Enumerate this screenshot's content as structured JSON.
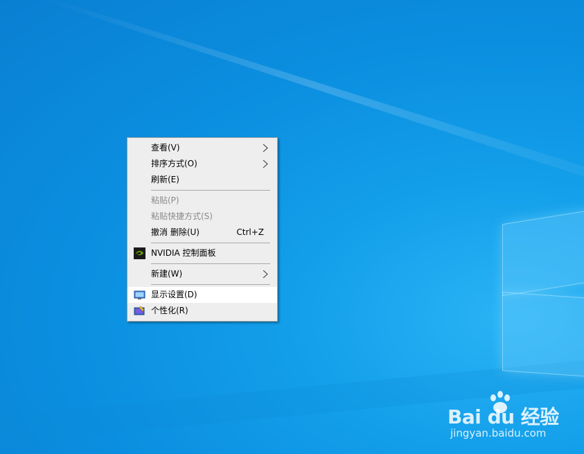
{
  "desktop": {
    "background_color": "#0b8fe0",
    "accent_color": "#2ab4f5"
  },
  "context_menu": {
    "background_color": "#eeeeee",
    "hover_color": "#ffffff",
    "groups": [
      [
        {
          "label": "查看(V)",
          "submenu": true
        },
        {
          "label": "排序方式(O)",
          "submenu": true
        },
        {
          "label": "刷新(E)"
        }
      ],
      [
        {
          "label": "粘贴(P)",
          "disabled": true
        },
        {
          "label": "粘贴快捷方式(S)",
          "disabled": true
        },
        {
          "label": "撤消 删除(U)",
          "shortcut": "Ctrl+Z"
        }
      ],
      [
        {
          "label": "NVIDIA 控制面板",
          "icon": "nvidia-icon"
        }
      ],
      [
        {
          "label": "新建(W)",
          "submenu": true
        }
      ],
      [
        {
          "label": "显示设置(D)",
          "icon": "display-settings-icon",
          "hovered": true
        },
        {
          "label": "个性化(R)",
          "icon": "personalize-icon"
        }
      ]
    ]
  },
  "watermark": {
    "brand": "Bai du 经验",
    "url": "jingyan.baidu.com"
  }
}
